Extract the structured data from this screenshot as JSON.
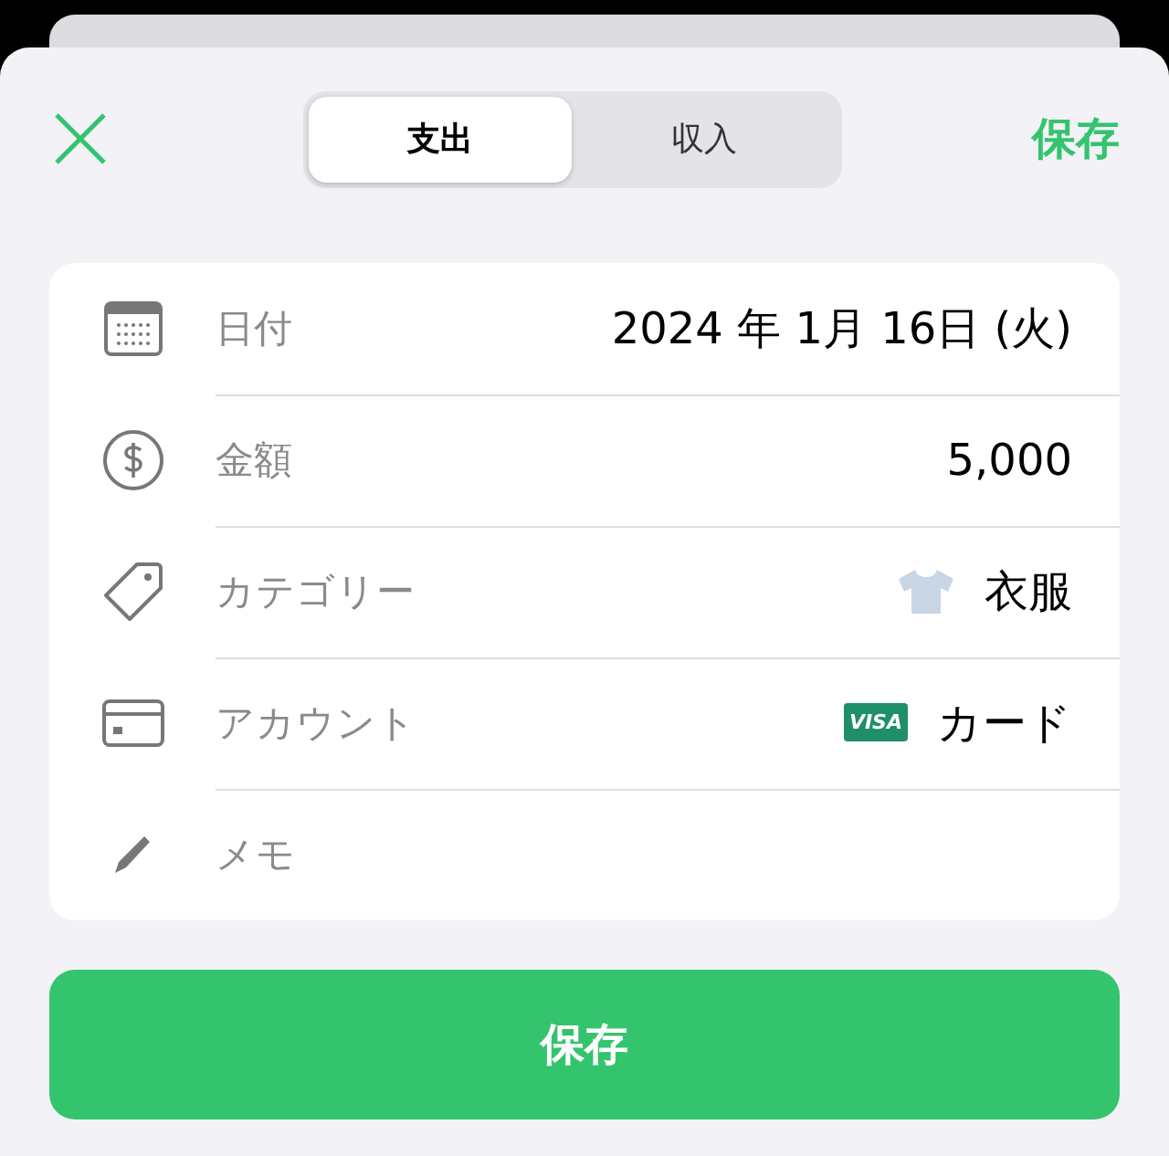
{
  "header": {
    "save": "保存"
  },
  "tabs": [
    {
      "label": "支出",
      "selected": true
    },
    {
      "label": "収入",
      "selected": false
    }
  ],
  "rows": [
    {
      "kind": "date",
      "label": "日付",
      "value": "2024 年 1月 16日 (火)"
    },
    {
      "kind": "amount",
      "label": "金額",
      "value": "5,000"
    },
    {
      "kind": "category",
      "label": "カテゴリー",
      "value": "衣服"
    },
    {
      "kind": "account",
      "label": "アカウント",
      "value": "カード",
      "badge": "VISA"
    },
    {
      "kind": "memo",
      "placeholder": "メモ"
    }
  ],
  "save_button": "保存"
}
